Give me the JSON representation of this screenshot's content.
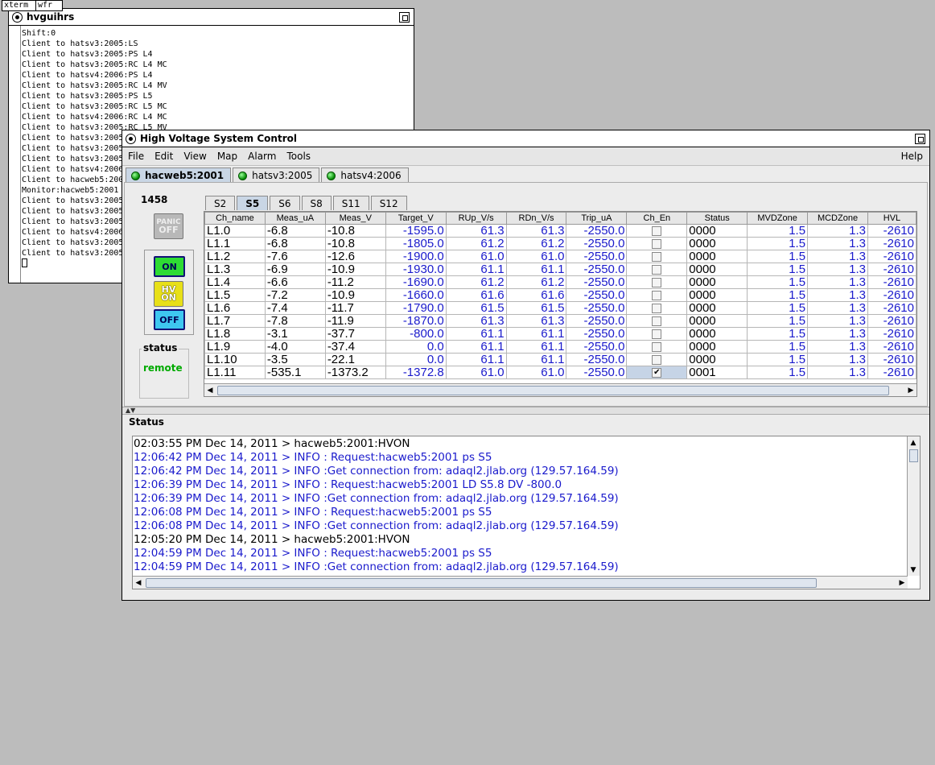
{
  "xterm": {
    "tab1": "xterm",
    "tab2": "wfr",
    "title": "hvguihrs",
    "lines": [
      "Shift:0",
      "Client to hatsv3:2005:LS",
      "Client to hatsv3:2005:PS L4",
      "Client to hatsv3:2005:RC L4 MC",
      "Client to hatsv4:2006:PS L4",
      "Client to hatsv3:2005:RC L4 MV",
      "Client to hatsv3:2005:PS L5",
      "Client to hatsv3:2005:RC L5 MC",
      "Client to hatsv4:2006:RC L4 MC",
      "Client to hatsv3:2005:RC L5 MV",
      "Client to hatsv3:2005",
      "Client to hatsv3:2005",
      "Client to hatsv3:2005",
      "Client to hatsv4:2006",
      "Client to hacweb5:200",
      "Monitor:hacweb5:2001",
      "Client to hatsv3:2005",
      "Client to hatsv3:2005",
      "Client to hatsv3:2005",
      "Client to hatsv4:2006",
      "Client to hatsv3:2005",
      "Client to hatsv3:2005"
    ]
  },
  "window": {
    "title": "High Voltage System Control"
  },
  "menu": {
    "file": "File",
    "edit": "Edit",
    "view": "View",
    "map": "Map",
    "alarm": "Alarm",
    "tools": "Tools",
    "help": "Help"
  },
  "servers": [
    "hacweb5:2001",
    "hatsv3:2005",
    "hatsv4:2006"
  ],
  "control": {
    "crate": "1458",
    "panic_top": "PANIC",
    "panic_bottom": "OFF",
    "on": "ON",
    "hv_top": "HV",
    "hv_bottom": "ON",
    "off": "OFF",
    "status_label": "status",
    "status_value": "remote"
  },
  "slots": [
    "S2",
    "S5",
    "S6",
    "S8",
    "S11",
    "S12"
  ],
  "table": {
    "columns": [
      "Ch_name",
      "Meas_uA",
      "Meas_V",
      "Target_V",
      "RUp_V/s",
      "RDn_V/s",
      "Trip_uA",
      "Ch_En",
      "Status",
      "MVDZone",
      "MCDZone",
      "HVL"
    ],
    "rows": [
      [
        "L1.0",
        "-6.8",
        "-10.8",
        "-1595.0",
        "61.3",
        "61.3",
        "-2550.0",
        false,
        "0000",
        "1.5",
        "1.3",
        "-2610"
      ],
      [
        "L1.1",
        "-6.8",
        "-10.8",
        "-1805.0",
        "61.2",
        "61.2",
        "-2550.0",
        false,
        "0000",
        "1.5",
        "1.3",
        "-2610"
      ],
      [
        "L1.2",
        "-7.6",
        "-12.6",
        "-1900.0",
        "61.0",
        "61.0",
        "-2550.0",
        false,
        "0000",
        "1.5",
        "1.3",
        "-2610"
      ],
      [
        "L1.3",
        "-6.9",
        "-10.9",
        "-1930.0",
        "61.1",
        "61.1",
        "-2550.0",
        false,
        "0000",
        "1.5",
        "1.3",
        "-2610"
      ],
      [
        "L1.4",
        "-6.6",
        "-11.2",
        "-1690.0",
        "61.2",
        "61.2",
        "-2550.0",
        false,
        "0000",
        "1.5",
        "1.3",
        "-2610"
      ],
      [
        "L1.5",
        "-7.2",
        "-10.9",
        "-1660.0",
        "61.6",
        "61.6",
        "-2550.0",
        false,
        "0000",
        "1.5",
        "1.3",
        "-2610"
      ],
      [
        "L1.6",
        "-7.4",
        "-11.7",
        "-1790.0",
        "61.5",
        "61.5",
        "-2550.0",
        false,
        "0000",
        "1.5",
        "1.3",
        "-2610"
      ],
      [
        "L1.7",
        "-7.8",
        "-11.9",
        "-1870.0",
        "61.3",
        "61.3",
        "-2550.0",
        false,
        "0000",
        "1.5",
        "1.3",
        "-2610"
      ],
      [
        "L1.8",
        "-3.1",
        "-37.7",
        "-800.0",
        "61.1",
        "61.1",
        "-2550.0",
        false,
        "0000",
        "1.5",
        "1.3",
        "-2610"
      ],
      [
        "L1.9",
        "-4.0",
        "-37.4",
        "0.0",
        "61.1",
        "61.1",
        "-2550.0",
        false,
        "0000",
        "1.5",
        "1.3",
        "-2610"
      ],
      [
        "L1.10",
        "-3.5",
        "-22.1",
        "0.0",
        "61.1",
        "61.1",
        "-2550.0",
        false,
        "0000",
        "1.5",
        "1.3",
        "-2610"
      ],
      [
        "L1.11",
        "-535.1",
        "-1373.2",
        "-1372.8",
        "61.0",
        "61.0",
        "-2550.0",
        true,
        "0001",
        "1.5",
        "1.3",
        "-2610"
      ]
    ]
  },
  "status_panel": {
    "title": "Status",
    "lines": [
      {
        "text": "02:03:55 PM Dec 14, 2011 > hacweb5:2001:HVON",
        "info": false
      },
      {
        "text": "12:06:42 PM Dec 14, 2011 > INFO : Request:hacweb5:2001 ps S5",
        "info": true
      },
      {
        "text": "12:06:42 PM Dec 14, 2011 > INFO :Get connection from: adaql2.jlab.org (129.57.164.59)",
        "info": true
      },
      {
        "text": "12:06:39 PM Dec 14, 2011 > INFO : Request:hacweb5:2001 LD S5.8 DV -800.0",
        "info": true
      },
      {
        "text": "12:06:39 PM Dec 14, 2011 > INFO :Get connection from: adaql2.jlab.org (129.57.164.59)",
        "info": true
      },
      {
        "text": "12:06:08 PM Dec 14, 2011 > INFO : Request:hacweb5:2001 ps S5",
        "info": true
      },
      {
        "text": "12:06:08 PM Dec 14, 2011 > INFO :Get connection from: adaql2.jlab.org (129.57.164.59)",
        "info": true
      },
      {
        "text": "12:05:20 PM Dec 14, 2011 > hacweb5:2001:HVON",
        "info": false
      },
      {
        "text": "12:04:59 PM Dec 14, 2011 > INFO : Request:hacweb5:2001 ps S5",
        "info": true
      },
      {
        "text": "12:04:59 PM Dec 14, 2011 > INFO :Get connection from: adaql2.jlab.org (129.57.164.59)",
        "info": true
      }
    ]
  },
  "colors": {
    "info_text": "#1a1acc",
    "status_remote": "#00aa00",
    "on_button": "#2edb33",
    "off_button": "#3ec7f0",
    "hvon_button": "#e8e018"
  }
}
